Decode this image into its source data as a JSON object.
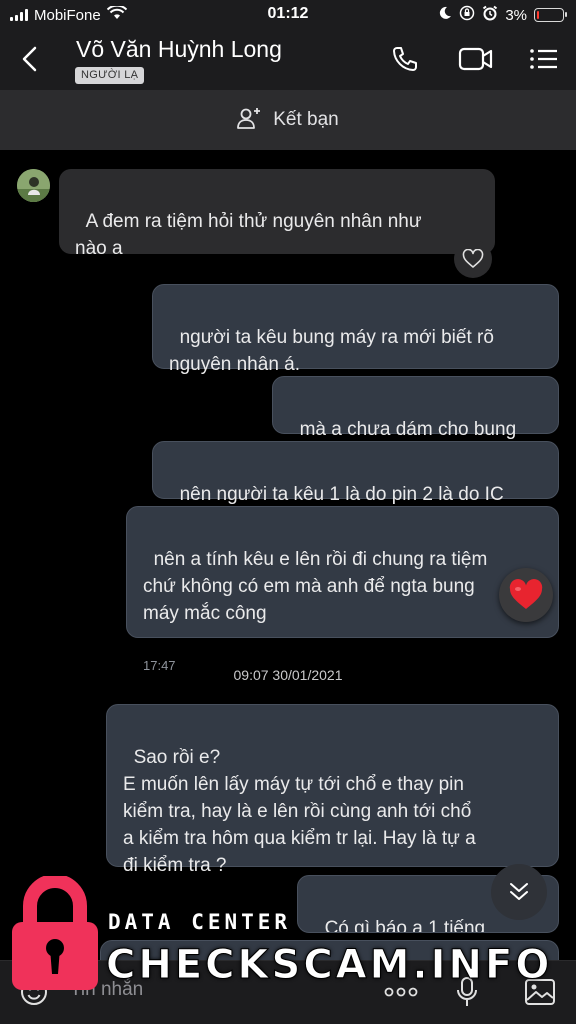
{
  "status_bar": {
    "carrier": "MobiFone",
    "time": "01:12",
    "battery": "3%",
    "battery_level": 0.03,
    "icons": [
      "signal-icon",
      "wifi-icon",
      "moon-icon",
      "orientation-lock-icon",
      "alarm-icon",
      "battery-icon"
    ]
  },
  "header": {
    "name": "Võ Văn Huỳnh Long",
    "badge": "NGƯỜI LẠ",
    "icons": [
      "back-icon",
      "phone-icon",
      "video-icon",
      "menu-icon"
    ]
  },
  "add_friend": {
    "label": "Kết bạn",
    "icon": "add-person-icon"
  },
  "messages": [
    {
      "side": "in",
      "text": "A đem ra tiệm hỏi thử nguyên nhân như\nnào a"
    },
    {
      "side": "out",
      "text": "người ta kêu bung máy ra mới biết rõ\nnguyên nhân á."
    },
    {
      "side": "out",
      "text": "mà a chưa dám cho bung"
    },
    {
      "side": "out",
      "text": "nên người ta kêu 1 là do pin 2 là do IC"
    },
    {
      "side": "out",
      "text": "nên a tính kêu e lên rồi đi chung ra tiệm\nchứ không có em mà anh để ngta bung\nmáy mắc công",
      "time": "17:47"
    },
    {
      "side": "out",
      "text": "Sao rồi e?\nE muốn lên lấy máy tự tới chổ e thay pin\nkiểm tra, hay là e lên rồi cùng anh tới chổ\na kiểm tra hôm qua kiểm tr lại. Hay là tự a\nđi kiểm tra ?"
    },
    {
      "side": "out",
      "text": "Có gì báo a 1 tiếng"
    }
  ],
  "date_separator": "09:07 30/01/2021",
  "reaction": {
    "icon": "heart-icon",
    "color": "#e8242f"
  },
  "composer": {
    "placeholder": "Tin nhắn",
    "icons": [
      "emoji-icon",
      "more-icon",
      "microphone-icon",
      "image-icon"
    ]
  },
  "watermark": {
    "line1": "DATA CENTER",
    "line2": "CHECKSCAM.INFO",
    "lock_color": "#f0325a"
  }
}
